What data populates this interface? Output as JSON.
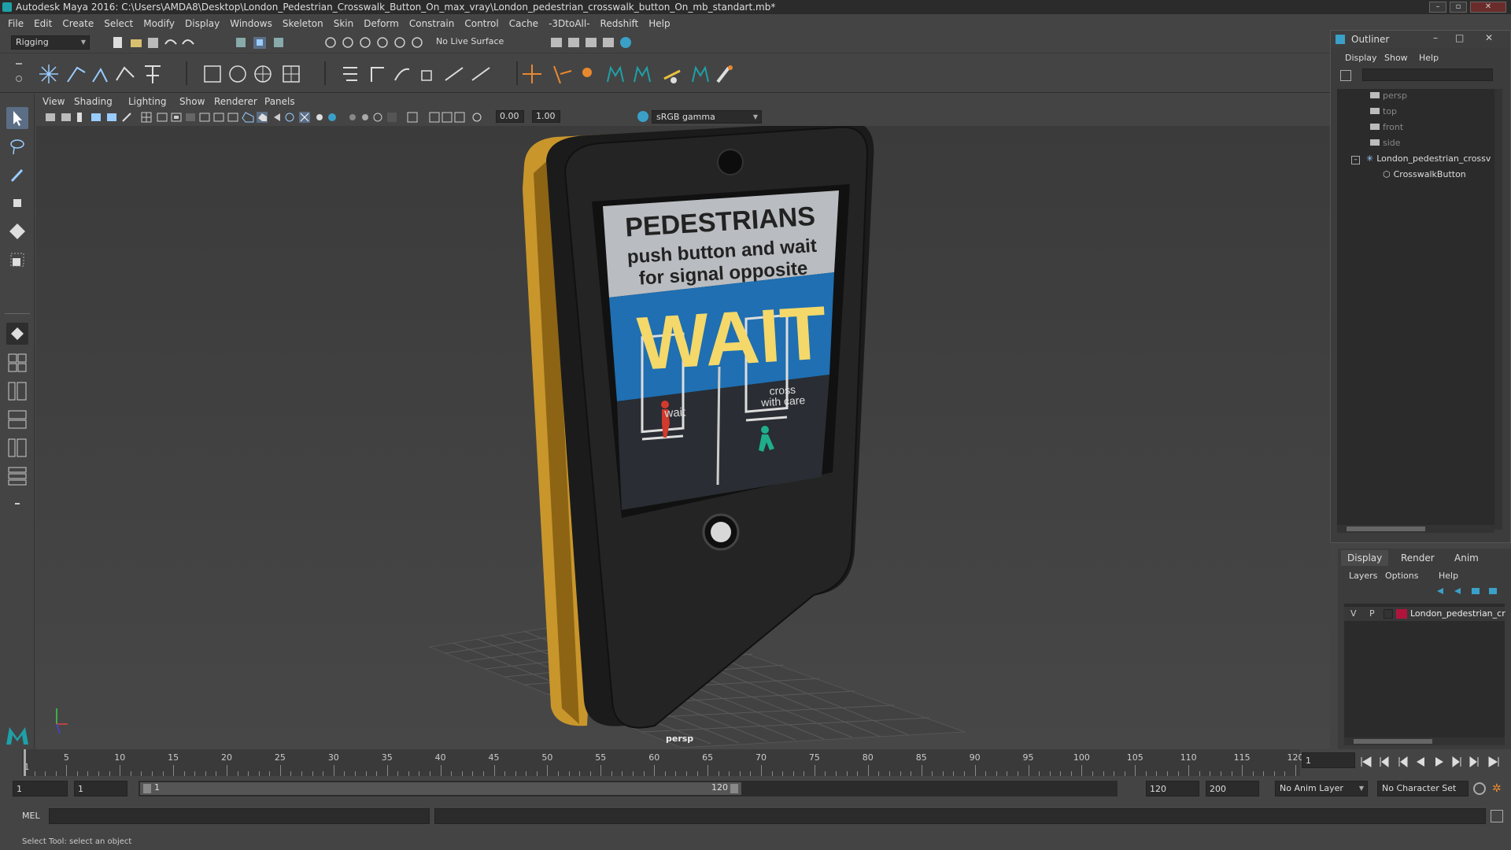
{
  "window": {
    "title": "Autodesk Maya 2016: C:\\Users\\AMDA8\\Desktop\\London_Pedestrian_Crosswalk_Button_On_max_vray\\London_pedestrian_crosswalk_button_On_mb_standart.mb*"
  },
  "menubar": [
    "File",
    "Edit",
    "Create",
    "Select",
    "Modify",
    "Display",
    "Windows",
    "Skeleton",
    "Skin",
    "Deform",
    "Constrain",
    "Control",
    "Cache",
    "-3DtoAll-",
    "Redshift",
    "Help"
  ],
  "statusline": {
    "menu_set": "Rigging",
    "live_surface": "No Live Surface"
  },
  "panel_menu": [
    "View",
    "Shading",
    "Lighting",
    "Show",
    "Renderer",
    "Panels"
  ],
  "panel_toolbar": {
    "exposure": "0.00",
    "gamma": "1.00",
    "color_space": "sRGB gamma"
  },
  "viewport": {
    "camera_label": "persp",
    "sign": {
      "heading": "PEDESTRIANS",
      "line1": "push button and wait",
      "line2": "for signal opposite",
      "status": "WAIT",
      "left_label": "wait",
      "right_label_1": "cross",
      "right_label_2": "with care"
    },
    "colors": {
      "body": "#1e1e1e",
      "side": "#c9962c",
      "blue_band": "#1f6fb2",
      "wait_text": "#f4d86a",
      "red_man": "#d23a2e",
      "green_man": "#1fae8c"
    }
  },
  "outliner": {
    "title": "Outliner",
    "menu": [
      "Display",
      "Show",
      "Help"
    ],
    "items": [
      {
        "label": "persp",
        "type": "camera"
      },
      {
        "label": "top",
        "type": "camera"
      },
      {
        "label": "front",
        "type": "camera"
      },
      {
        "label": "side",
        "type": "camera"
      },
      {
        "label": "London_pedestrian_crossv",
        "type": "group"
      },
      {
        "label": "CrosswalkButton",
        "type": "mesh"
      }
    ]
  },
  "layer_editor": {
    "tabs": [
      "Display",
      "Render",
      "Anim"
    ],
    "menu": [
      "Layers",
      "Options",
      "Help"
    ],
    "layer": {
      "v": "V",
      "p": "P",
      "name": "London_pedestrian_cr",
      "color": "#b0143c"
    }
  },
  "timeslider": {
    "ticks": [
      1,
      5,
      10,
      15,
      20,
      25,
      30,
      35,
      40,
      45,
      50,
      55,
      60,
      65,
      70,
      75,
      80,
      85,
      90,
      95,
      100,
      105,
      110,
      115,
      120
    ],
    "current_frame": "1"
  },
  "rangeslider": {
    "start": "1",
    "playback_start": "1",
    "range_start_label": "1",
    "range_end_label": "120",
    "playback_end": "120",
    "end": "200",
    "anim_layer": "No Anim Layer",
    "char_set": "No Character Set"
  },
  "cmdline": {
    "label": "MEL"
  },
  "helpline": {
    "text": "Select Tool: select an object"
  }
}
